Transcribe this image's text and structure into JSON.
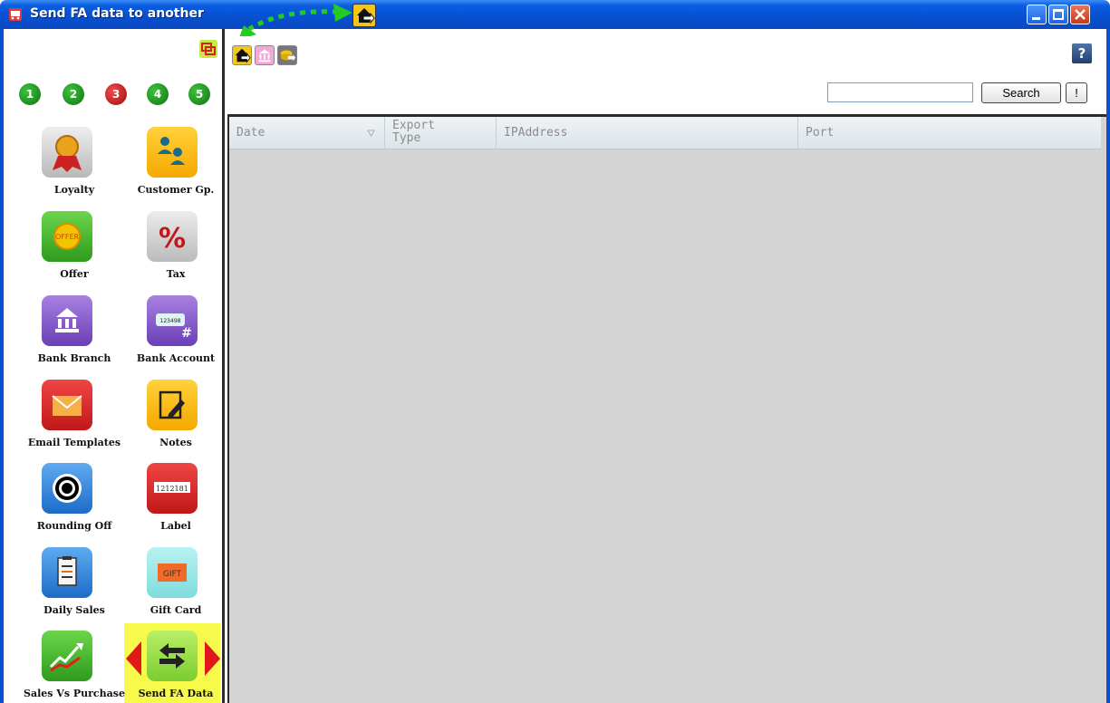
{
  "window": {
    "title": "Send FA data to another",
    "title_color": "#ffffff",
    "titlebar_color": "#0a5ce0"
  },
  "sidebar": {
    "steps": [
      {
        "label": "1",
        "color": "#137313"
      },
      {
        "label": "2",
        "color": "#137313"
      },
      {
        "label": "3",
        "color": "#a01010"
      },
      {
        "label": "4",
        "color": "#137313"
      },
      {
        "label": "5",
        "color": "#137313"
      }
    ],
    "items": [
      {
        "label": "Loyalty",
        "icon": "ribbon-award-icon"
      },
      {
        "label": "Customer Gp.",
        "icon": "people-group-icon"
      },
      {
        "label": "Offer",
        "icon": "offer-badge-icon"
      },
      {
        "label": "Tax",
        "icon": "percent-icon"
      },
      {
        "label": "Bank Branch",
        "icon": "bank-building-icon"
      },
      {
        "label": "Bank Account",
        "icon": "account-card-icon"
      },
      {
        "label": "Email Templates",
        "icon": "envelope-icon"
      },
      {
        "label": "Notes",
        "icon": "notepad-pencil-icon"
      },
      {
        "label": "Rounding Off",
        "icon": "target-icon"
      },
      {
        "label": "Label",
        "icon": "barcode-label-icon"
      },
      {
        "label": "Daily Sales",
        "icon": "clipboard-report-icon"
      },
      {
        "label": "Gift Card",
        "icon": "gift-card-icon"
      },
      {
        "label": "Sales Vs Purchase",
        "icon": "trend-chart-icon"
      },
      {
        "label": "Send FA Data",
        "icon": "transfer-arrows-icon",
        "selected": true
      }
    ],
    "gift_card_text": "GIFT",
    "account_card_text": "123498",
    "label_text": "1212181",
    "offer_text": "OFFER"
  },
  "toolbar": {
    "buttons": [
      "send-home-icon",
      "send-bank-icon",
      "send-coins-icon"
    ],
    "help_label": "?"
  },
  "search": {
    "value": "",
    "button_label": "Search",
    "extra_button_label": "!"
  },
  "grid": {
    "columns": [
      {
        "label": "Date"
      },
      {
        "label": "Export Type"
      },
      {
        "label": "IPAddress"
      },
      {
        "label": "Port"
      }
    ],
    "rows": []
  },
  "colors": {
    "highlight": "#f7f94b",
    "grid_background": "#d4d4d4",
    "callout_arrow": "#22cc22"
  }
}
